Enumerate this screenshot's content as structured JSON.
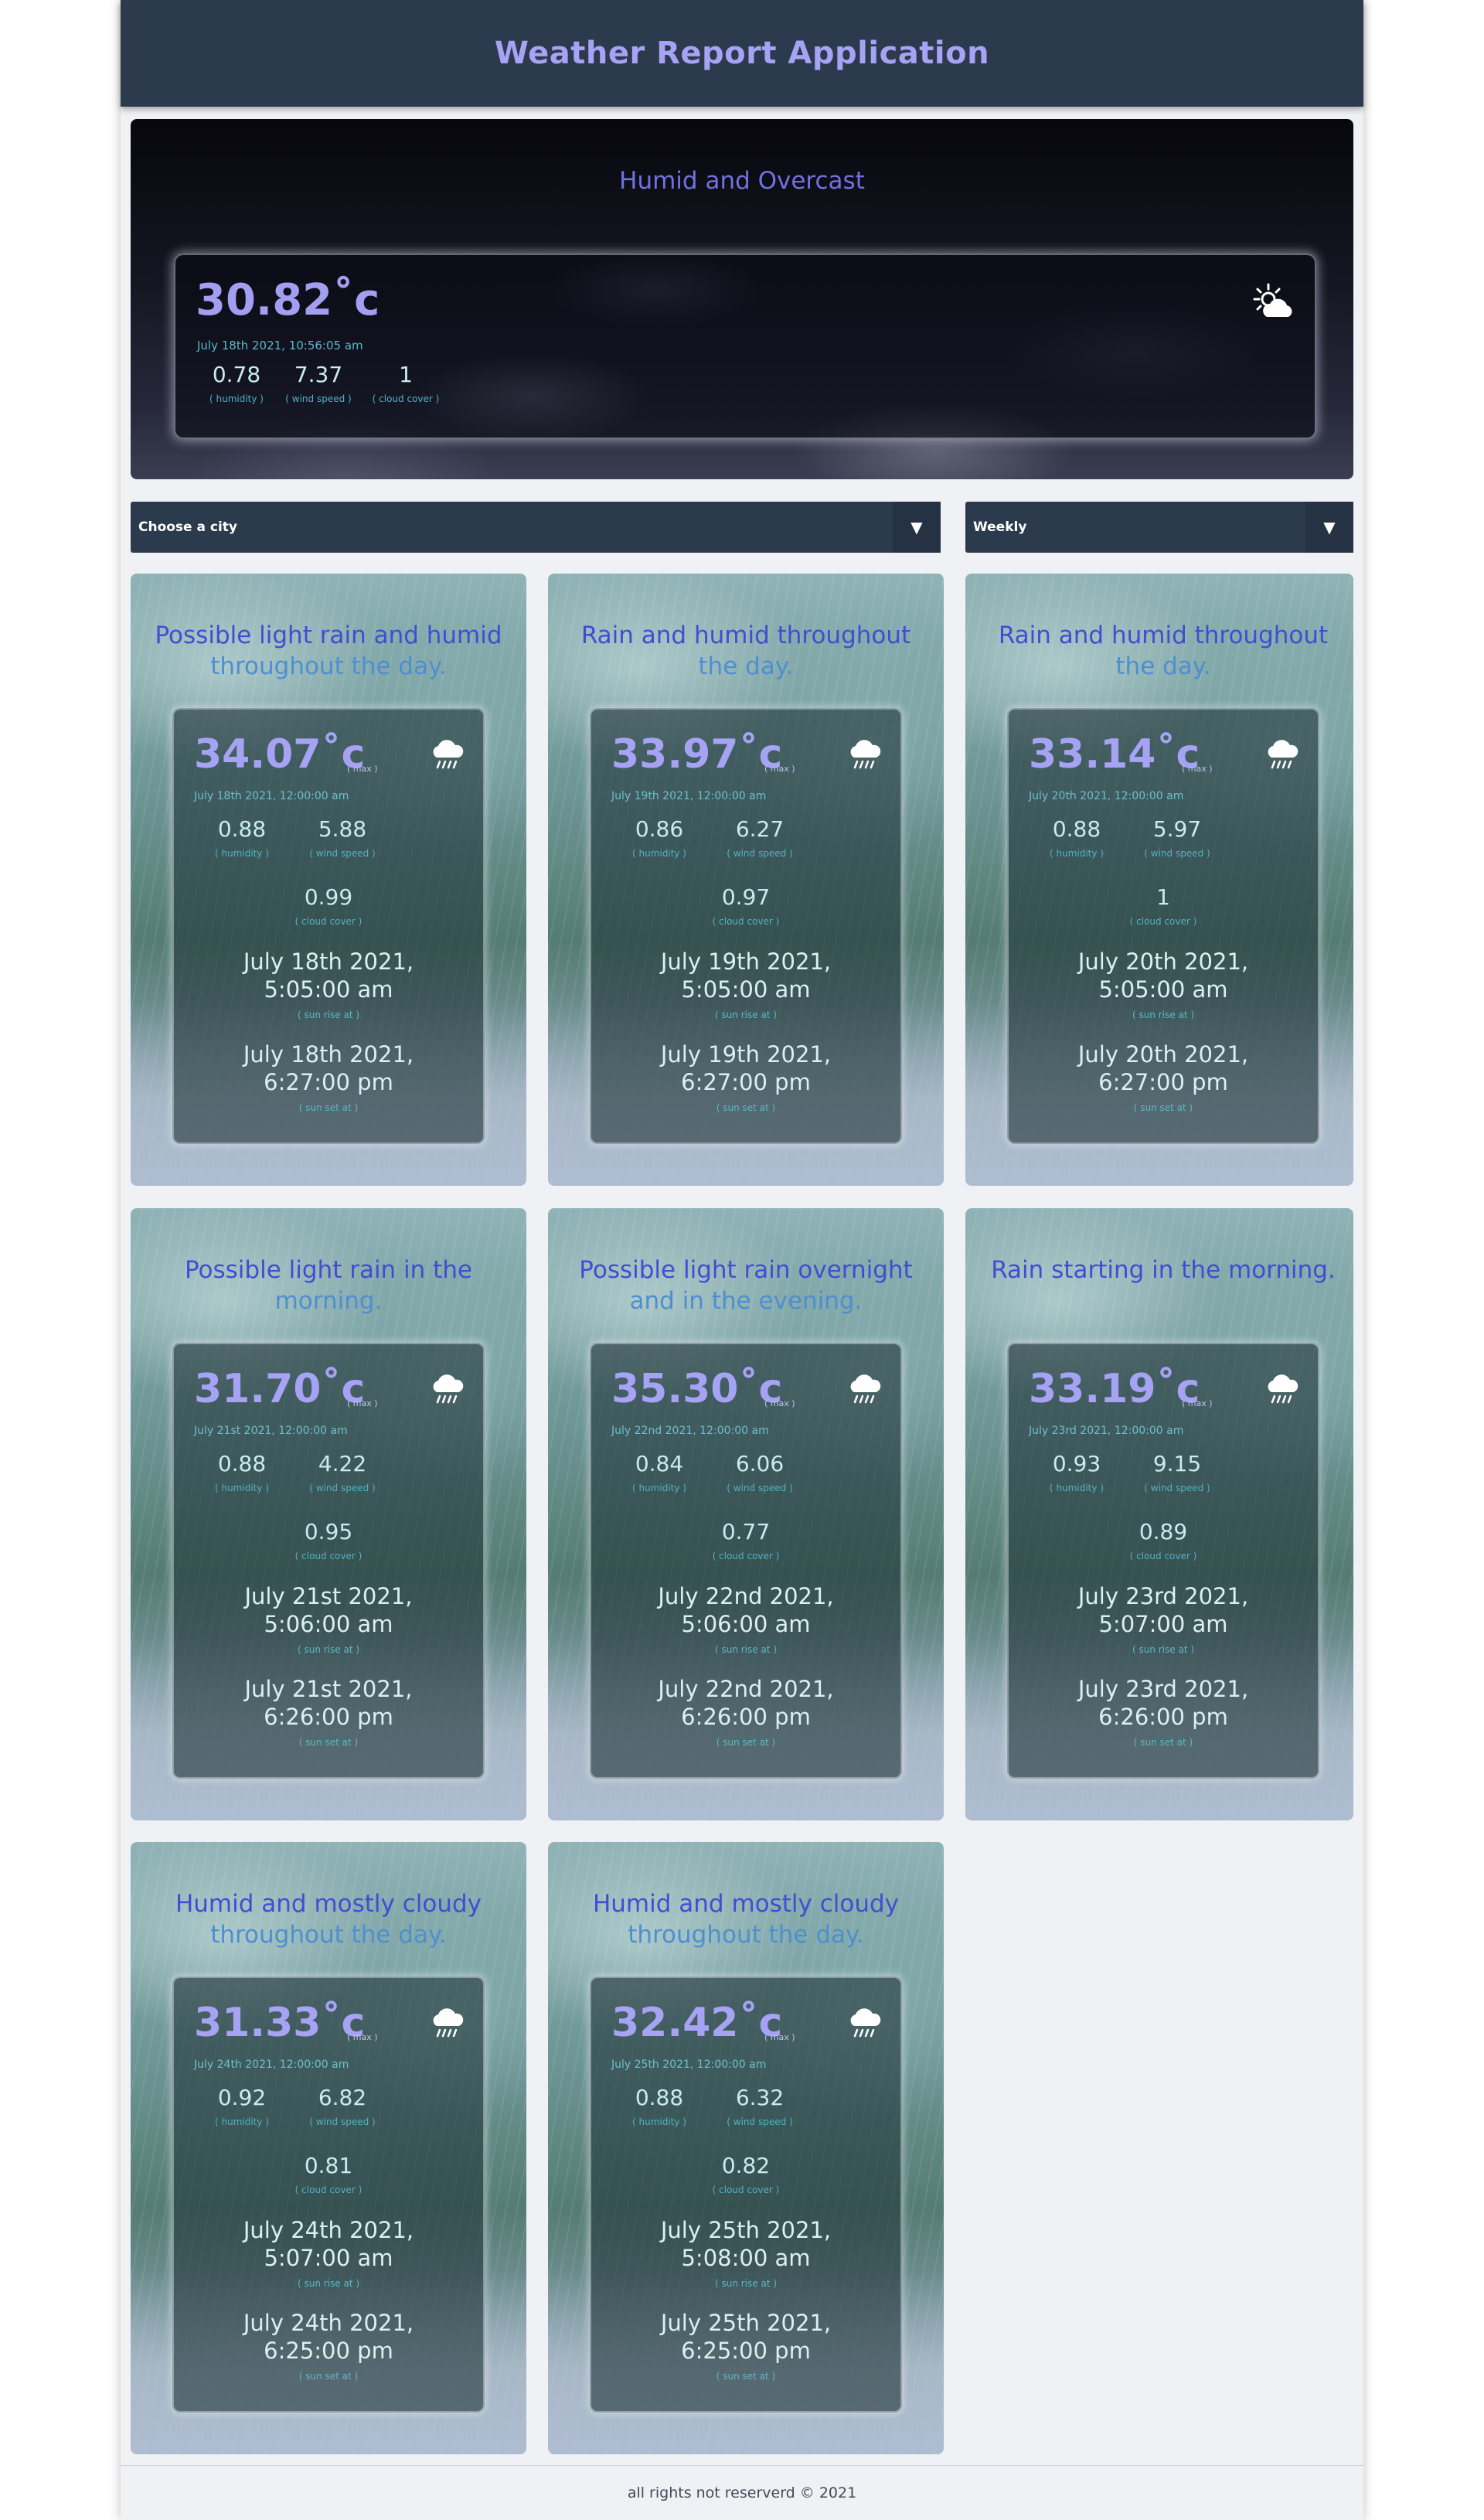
{
  "header": {
    "title": "Weather Report Application"
  },
  "current": {
    "summary": "Humid and Overcast",
    "temperature": "30.82˚c",
    "datetime": "July 18th 2021, 10:56:05 am",
    "humidity": "0.78",
    "humidity_label": "( humidity )",
    "wind_speed": "7.37",
    "wind_speed_label": "( wind speed )",
    "cloud_cover": "1",
    "cloud_cover_label": "( cloud cover )",
    "icon": "partly-cloudy-day-icon"
  },
  "controls": {
    "city_select": "Choose a city",
    "period_select": "Weekly"
  },
  "labels": {
    "max": "( max )",
    "humidity": "( humidity )",
    "wind_speed": "( wind speed )",
    "cloud_cover": "( cloud cover )",
    "sunrise": "( sun rise at )",
    "sunset": "( sun set at )"
  },
  "forecast": [
    {
      "summary_1": "Possible light rain and humid",
      "summary_2": "throughout the day.",
      "temp": "34.07˚c",
      "date": "July 18th 2021, 12:00:00 am",
      "humidity": "0.88",
      "wind": "5.88",
      "cloud": "0.99",
      "sunrise_date": "July 18th 2021,",
      "sunrise_time": "5:05:00 am",
      "sunset_date": "July 18th 2021,",
      "sunset_time": "6:27:00 pm",
      "icon": "rain-icon"
    },
    {
      "summary_1": "Rain and humid throughout",
      "summary_2": "the day.",
      "temp": "33.97˚c",
      "date": "July 19th 2021, 12:00:00 am",
      "humidity": "0.86",
      "wind": "6.27",
      "cloud": "0.97",
      "sunrise_date": "July 19th 2021,",
      "sunrise_time": "5:05:00 am",
      "sunset_date": "July 19th 2021,",
      "sunset_time": "6:27:00 pm",
      "icon": "rain-icon"
    },
    {
      "summary_1": "Rain and humid throughout",
      "summary_2": "the day.",
      "temp": "33.14˚c",
      "date": "July 20th 2021, 12:00:00 am",
      "humidity": "0.88",
      "wind": "5.97",
      "cloud": "1",
      "sunrise_date": "July 20th 2021,",
      "sunrise_time": "5:05:00 am",
      "sunset_date": "July 20th 2021,",
      "sunset_time": "6:27:00 pm",
      "icon": "rain-icon"
    },
    {
      "summary_1": "Possible light rain in the",
      "summary_2": "morning.",
      "temp": "31.70˚c",
      "date": "July 21st 2021, 12:00:00 am",
      "humidity": "0.88",
      "wind": "4.22",
      "cloud": "0.95",
      "sunrise_date": "July 21st 2021,",
      "sunrise_time": "5:06:00 am",
      "sunset_date": "July 21st 2021,",
      "sunset_time": "6:26:00 pm",
      "icon": "rain-icon"
    },
    {
      "summary_1": "Possible light rain overnight",
      "summary_2": "and in the evening.",
      "temp": "35.30˚c",
      "date": "July 22nd 2021, 12:00:00 am",
      "humidity": "0.84",
      "wind": "6.06",
      "cloud": "0.77",
      "sunrise_date": "July 22nd 2021,",
      "sunrise_time": "5:06:00 am",
      "sunset_date": "July 22nd 2021,",
      "sunset_time": "6:26:00 pm",
      "icon": "rain-icon"
    },
    {
      "summary_1": "Rain starting in the morning.",
      "summary_2": "",
      "temp": "33.19˚c",
      "date": "July 23rd 2021, 12:00:00 am",
      "humidity": "0.93",
      "wind": "9.15",
      "cloud": "0.89",
      "sunrise_date": "July 23rd 2021,",
      "sunrise_time": "5:07:00 am",
      "sunset_date": "July 23rd 2021,",
      "sunset_time": "6:26:00 pm",
      "icon": "rain-icon"
    },
    {
      "summary_1": "Humid and mostly cloudy",
      "summary_2": "throughout the day.",
      "temp": "31.33˚c",
      "date": "July 24th 2021, 12:00:00 am",
      "humidity": "0.92",
      "wind": "6.82",
      "cloud": "0.81",
      "sunrise_date": "July 24th 2021,",
      "sunrise_time": "5:07:00 am",
      "sunset_date": "July 24th 2021,",
      "sunset_time": "6:25:00 pm",
      "icon": "rain-icon"
    },
    {
      "summary_1": "Humid and mostly cloudy",
      "summary_2": "throughout the day.",
      "temp": "32.42˚c",
      "date": "July 25th 2021, 12:00:00 am",
      "humidity": "0.88",
      "wind": "6.32",
      "cloud": "0.82",
      "sunrise_date": "July 25th 2021,",
      "sunrise_time": "5:08:00 am",
      "sunset_date": "July 25th 2021,",
      "sunset_time": "6:25:00 pm",
      "icon": "rain-icon"
    }
  ],
  "footer": {
    "text": "all rights not reserverd © 2021"
  }
}
